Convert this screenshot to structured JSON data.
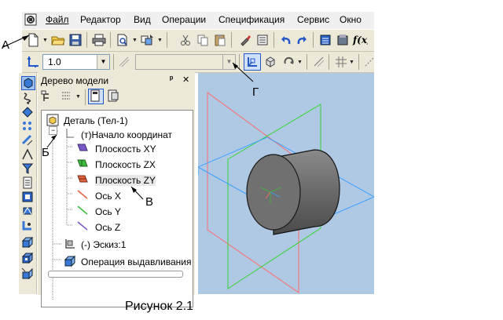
{
  "menubar": {
    "items": [
      {
        "label": "Файл"
      },
      {
        "label": "Редактор"
      },
      {
        "label": "Вид"
      },
      {
        "label": "Операции"
      },
      {
        "label": "Спецификация"
      },
      {
        "label": "Сервис"
      },
      {
        "label": "Окно"
      }
    ]
  },
  "toolbar2": {
    "scale_value": "1.0"
  },
  "tree": {
    "title": "Дерево модели",
    "pin_glyph": "ᵖ",
    "close_glyph": "✕",
    "nodes": [
      {
        "label": "Деталь (Тел-1)"
      },
      {
        "label": "(т)Начало координат"
      },
      {
        "label": "Плоскость XY"
      },
      {
        "label": "Плоскость ZX"
      },
      {
        "label": "Плоскость ZY"
      },
      {
        "label": "Ось X"
      },
      {
        "label": "Ось Y"
      },
      {
        "label": "Ось Z"
      },
      {
        "label": "(-) Эскиз:1"
      },
      {
        "label": "Операция выдавливания"
      }
    ],
    "expander_glyph": "−"
  },
  "annotations": {
    "a": "А",
    "b": "Б",
    "v": "В",
    "g": "Г"
  },
  "caption": "Рисунок 2.1",
  "colors": {
    "viewport_bg": "#afc8e4",
    "plane_xy": "#3aa0ff",
    "plane_zx": "#33d633",
    "plane_zy": "#ff6b6b"
  }
}
